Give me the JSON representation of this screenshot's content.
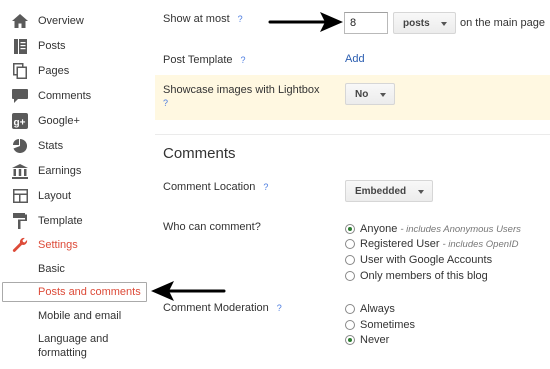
{
  "sidebar": {
    "items": [
      {
        "label": "Overview",
        "icon": "home-icon"
      },
      {
        "label": "Posts",
        "icon": "posts-icon"
      },
      {
        "label": "Pages",
        "icon": "pages-icon"
      },
      {
        "label": "Comments",
        "icon": "comments-icon"
      },
      {
        "label": "Google+",
        "icon": "google-plus-icon"
      },
      {
        "label": "Stats",
        "icon": "stats-icon"
      },
      {
        "label": "Earnings",
        "icon": "earnings-icon"
      },
      {
        "label": "Layout",
        "icon": "layout-icon"
      },
      {
        "label": "Template",
        "icon": "template-icon"
      },
      {
        "label": "Settings",
        "icon": "wrench-icon"
      }
    ],
    "settings_sub": {
      "basic": "Basic",
      "posts_comments": "Posts and comments",
      "mobile_email": "Mobile and email",
      "language_1": "Language and",
      "language_2": "formatting"
    },
    "accent_color": "#dd4b39"
  },
  "posts": {
    "show_at_most_label": "Show at most",
    "show_at_most_value": "8",
    "unit": "posts",
    "suffix": "on the main page",
    "template_label": "Post Template",
    "template_link": "Add",
    "lightbox_label": "Showcase images with Lightbox",
    "lightbox_value": "No",
    "help": "?"
  },
  "comments": {
    "title": "Comments",
    "location_label": "Comment Location",
    "location_value": "Embedded",
    "who_label": "Who can comment?",
    "who_options": [
      {
        "label": "Anyone",
        "hint": "- includes Anonymous Users",
        "selected": true
      },
      {
        "label": "Registered User",
        "hint": "- includes OpenID",
        "selected": false
      },
      {
        "label": "User with Google Accounts",
        "hint": "",
        "selected": false
      },
      {
        "label": "Only members of this blog",
        "hint": "",
        "selected": false
      }
    ],
    "moderation_label": "Comment Moderation",
    "moderation_options": [
      {
        "label": "Always",
        "selected": false
      },
      {
        "label": "Sometimes",
        "selected": false
      },
      {
        "label": "Never",
        "selected": true
      }
    ]
  }
}
